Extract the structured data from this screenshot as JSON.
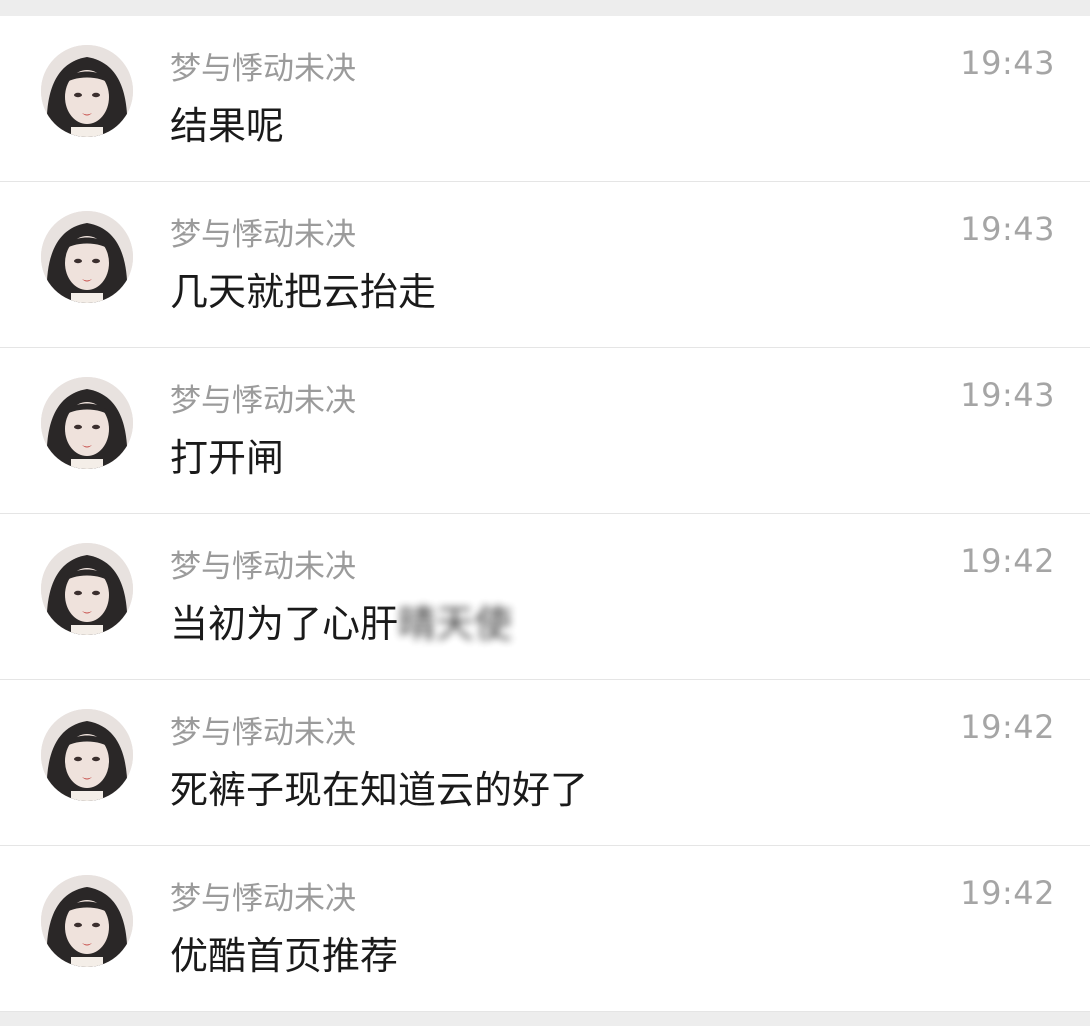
{
  "messages": [
    {
      "sender": "梦与悸动未决",
      "time": "19:43",
      "text": "结果呢",
      "blurred_tail": ""
    },
    {
      "sender": "梦与悸动未决",
      "time": "19:43",
      "text": "几天就把云抬走",
      "blurred_tail": ""
    },
    {
      "sender": "梦与悸动未决",
      "time": "19:43",
      "text": "打开闸",
      "blurred_tail": ""
    },
    {
      "sender": "梦与悸动未决",
      "time": "19:42",
      "text": "当初为了心肝",
      "blurred_tail": "晴天使"
    },
    {
      "sender": "梦与悸动未决",
      "time": "19:42",
      "text": "死裤子现在知道云的好了",
      "blurred_tail": ""
    },
    {
      "sender": "梦与悸动未决",
      "time": "19:42",
      "text": "优酷首页推荐",
      "blurred_tail": ""
    }
  ],
  "colors": {
    "background": "#ededed",
    "row_background": "#ffffff",
    "divider": "#e5e5e5",
    "sender": "#9b9b9b",
    "time": "#a5a5a5",
    "message": "#1a1a1a"
  },
  "icons": {
    "avatar": "user-avatar-photo"
  }
}
